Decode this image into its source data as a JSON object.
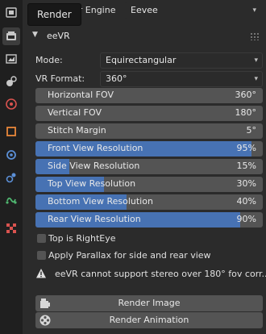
{
  "tooltip": {
    "text": "Render"
  },
  "topbar": {
    "render_engine_label": "der Engine",
    "render_engine_value": "Eevee"
  },
  "panel": {
    "title": "eeVR"
  },
  "mode": {
    "label": "Mode:",
    "value": "Equirectangular"
  },
  "vr_format": {
    "label": "VR Format:",
    "value": "360°"
  },
  "fields": {
    "horizontal_fov": {
      "name": "Horizontal FOV",
      "value": "360°"
    },
    "vertical_fov": {
      "name": "Vertical FOV",
      "value": "180°"
    },
    "stitch_margin": {
      "name": "Stitch Margin",
      "value": "5°"
    }
  },
  "resolutions": {
    "front": {
      "name": "Front View Resolution",
      "value": "95%",
      "fraction": 0.95
    },
    "side": {
      "name": "Side View Resolution",
      "value": "15%",
      "fraction": 0.15
    },
    "top": {
      "name": "Top View Resolution",
      "value": "30%",
      "fraction": 0.3
    },
    "bottom": {
      "name": "Bottom View Resolution",
      "value": "40%",
      "fraction": 0.4
    },
    "rear": {
      "name": "Rear View Resolution",
      "value": "90%",
      "fraction": 0.9
    }
  },
  "checkboxes": {
    "top_is_right_eye": {
      "label": "Top is RightEye",
      "checked": false
    },
    "apply_parallax": {
      "label": "Apply Parallax for side and rear view",
      "checked": false
    }
  },
  "warning": {
    "text": "eeVR cannot support stereo over 180° fov corr..."
  },
  "buttons": {
    "render_image": "Render Image",
    "render_animation": "Render Animation"
  },
  "colors": {
    "accent": "#4772b3",
    "field": "#545454",
    "background": "#2b2b2b",
    "sidebar": "#1f1f1f"
  },
  "sidebar_icons": [
    "tool-icon",
    "render-icon",
    "output-icon",
    "view-layer-icon",
    "scene-icon",
    "world-icon",
    "object-icon",
    "modifier-icon",
    "particles-icon",
    "physics-icon",
    "constraints-icon",
    "texture-icon"
  ]
}
